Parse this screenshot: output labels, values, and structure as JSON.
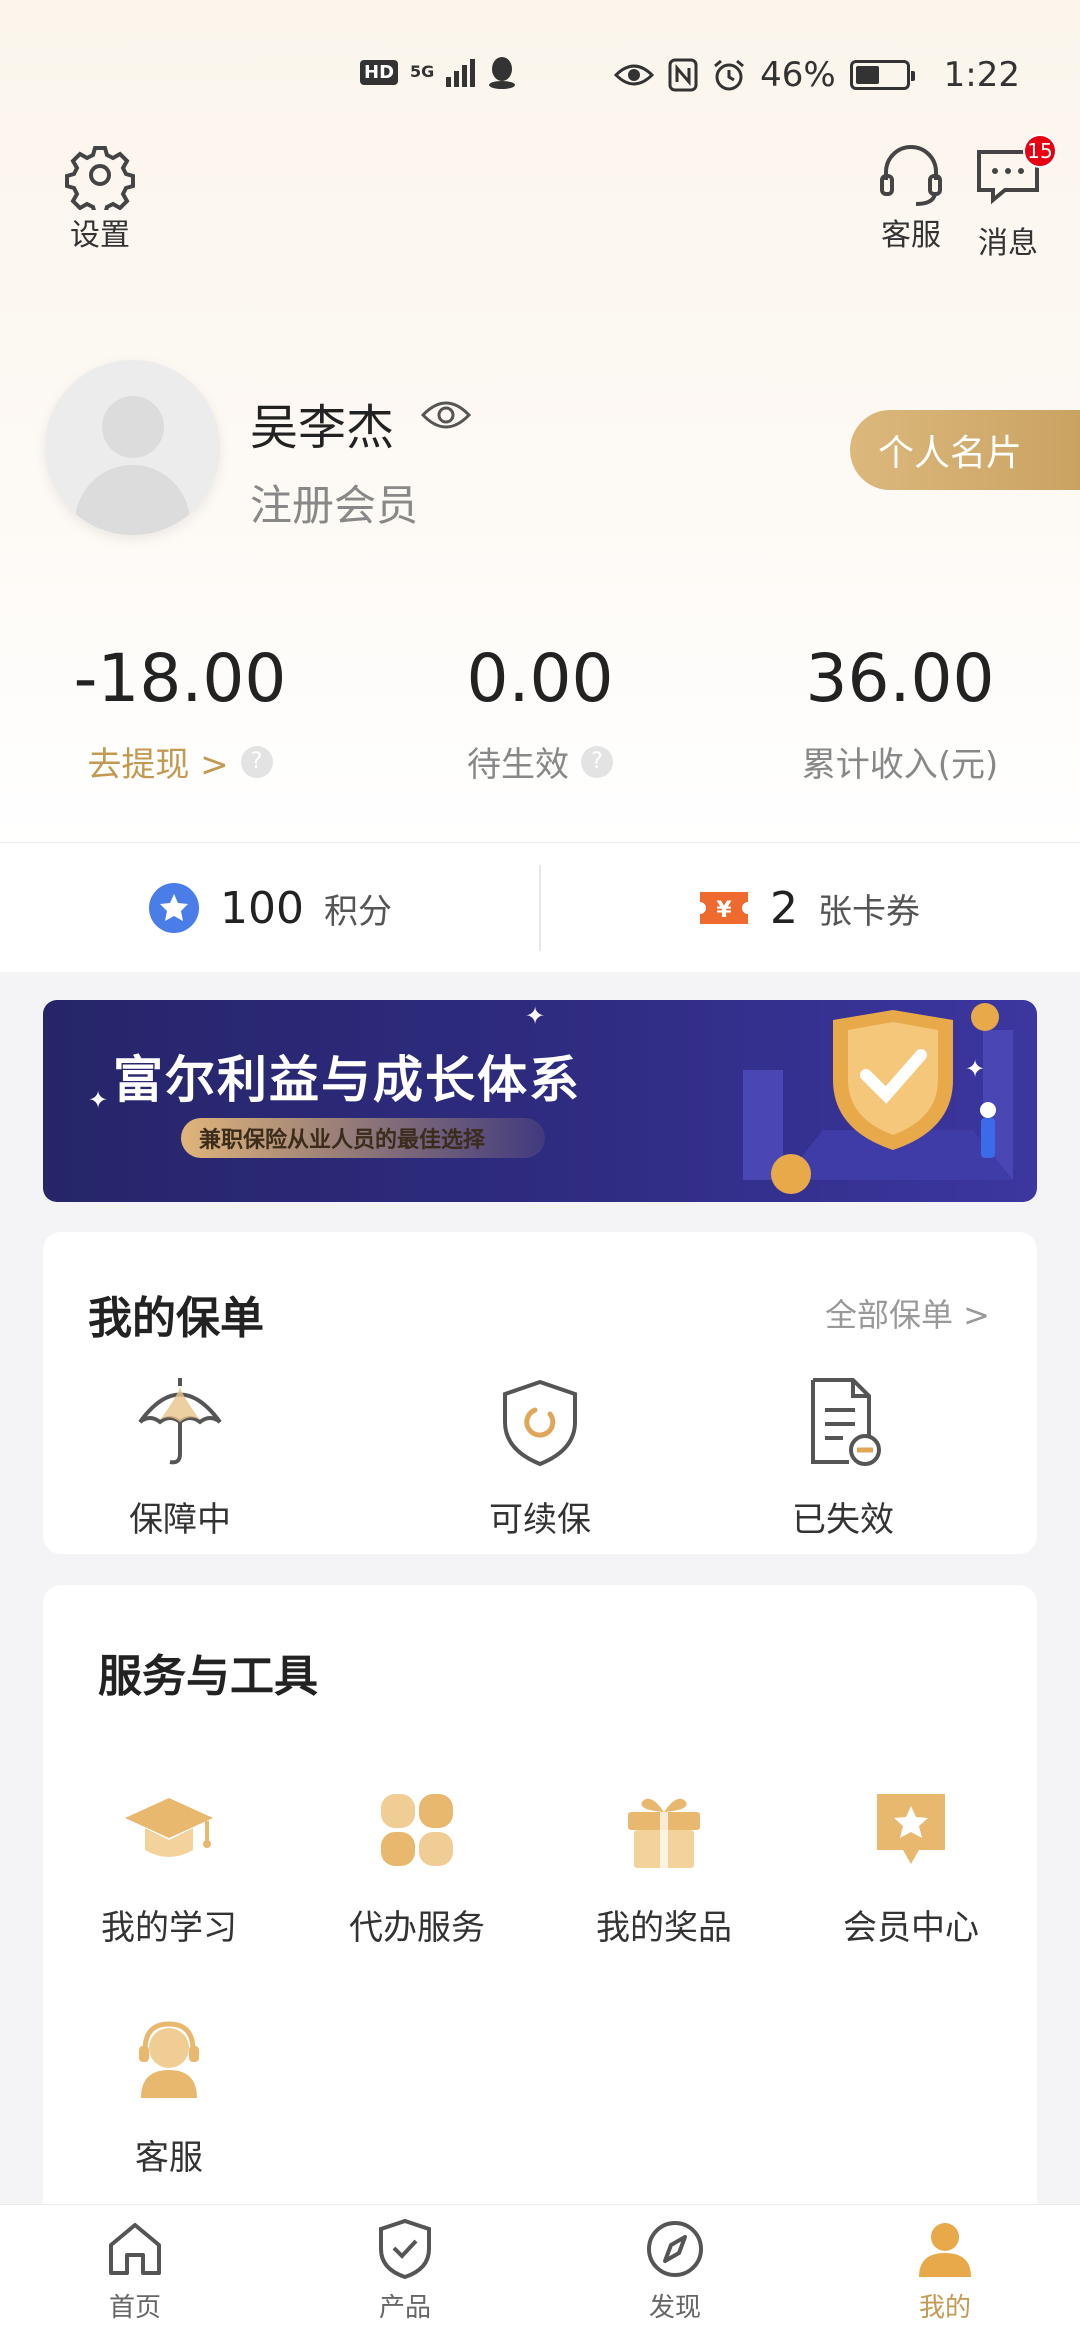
{
  "status_bar": {
    "hd": "HD",
    "network": "5G",
    "battery": "46%",
    "time": "1:22"
  },
  "header": {
    "settings_label": "设置",
    "service_label": "客服",
    "messages_label": "消息",
    "messages_badge": "15"
  },
  "profile": {
    "name": "吴李杰",
    "level": "注册会员",
    "card_button": "个人名片"
  },
  "stats": [
    {
      "value": "-18.00",
      "label": "去提现 >"
    },
    {
      "value": "0.00",
      "label": "待生效"
    },
    {
      "value": "36.00",
      "label": "累计收入(元)"
    }
  ],
  "points": {
    "value": "100",
    "label": "积分"
  },
  "coupons": {
    "value": "2",
    "label": "张卡券",
    "icon_text": "¥"
  },
  "banner": {
    "title": "富尔利益与成长体系",
    "subtitle": "兼职保险从业人员的最佳选择"
  },
  "policies": {
    "title": "我的保单",
    "all_link": "全部保单 >",
    "items": [
      {
        "label": "保障中",
        "icon": "umbrella-icon"
      },
      {
        "label": "可续保",
        "icon": "shield-icon"
      },
      {
        "label": "已失效",
        "icon": "document-expired-icon"
      }
    ]
  },
  "services": {
    "title": "服务与工具",
    "items": [
      {
        "label": "我的学习",
        "icon": "graduation-cap-icon"
      },
      {
        "label": "代办服务",
        "icon": "clover-icon"
      },
      {
        "label": "我的奖品",
        "icon": "gift-icon"
      },
      {
        "label": "会员中心",
        "icon": "member-star-icon"
      },
      {
        "label": "客服",
        "icon": "customer-service-icon"
      }
    ]
  },
  "tabs": [
    {
      "label": "首页",
      "icon": "home-icon"
    },
    {
      "label": "产品",
      "icon": "shield-check-icon"
    },
    {
      "label": "发现",
      "icon": "compass-icon"
    },
    {
      "label": "我的",
      "icon": "user-icon",
      "active": true
    }
  ],
  "colors": {
    "accent_gold": "#c59a55",
    "badge_red": "#e60012",
    "points_blue": "#4a7de8",
    "coupon_orange": "#ef6a2e",
    "banner_navy": "#2a2876"
  }
}
